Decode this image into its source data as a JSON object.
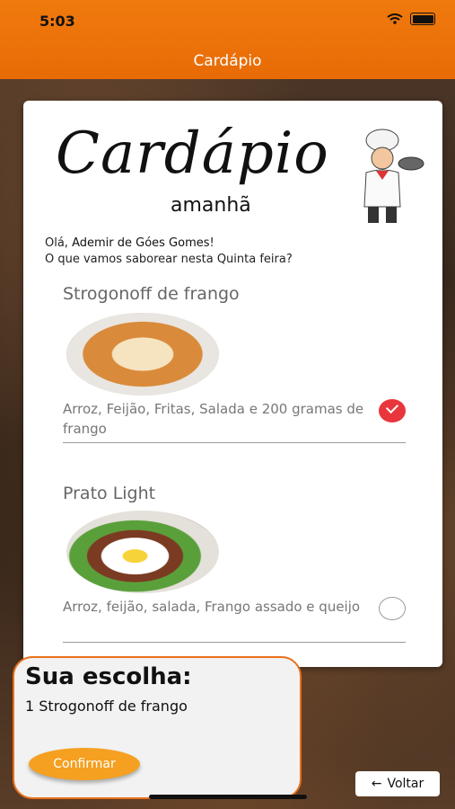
{
  "status_bar": {
    "time": "5:03"
  },
  "nav": {
    "title": "Cardápio"
  },
  "logo": {
    "word": "Cardápio",
    "sub": "amanhã"
  },
  "greeting": {
    "prefix": "Olá, ",
    "name": "Ademir de Góes Gomes",
    "suffix": "!",
    "question": "O que vamos saborear nesta Quinta feira?"
  },
  "dishes": [
    {
      "title": "Strogonoff de frango",
      "description": "Arroz, Feijão, Fritas, Salada e 200 gramas de frango",
      "selected": true
    },
    {
      "title": "Prato Light",
      "description": "Arroz, feijão, salada, Frango assado e queijo",
      "selected": false
    }
  ],
  "choice": {
    "title": "Sua escolha:",
    "item": "1 Strogonoff de frango",
    "confirm_label": "Confirmar"
  },
  "back": {
    "arrow": "←",
    "label": "Voltar"
  },
  "colors": {
    "accent": "#e86b06",
    "check": "#e8363c",
    "confirm": "#f5a020"
  }
}
